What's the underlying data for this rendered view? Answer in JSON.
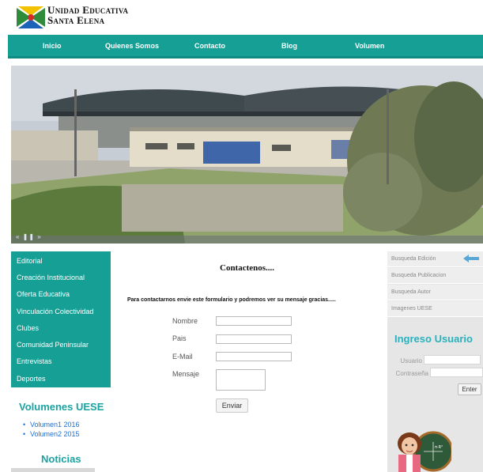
{
  "header": {
    "brand_line1": "Unidad Educativa",
    "brand_line2": "Santa Elena",
    "logo_icon": "school-logo-icon"
  },
  "nav": {
    "items": [
      "Inicio",
      "Quienes Somos",
      "Contacto",
      "Blog",
      "Volumen"
    ]
  },
  "banner": {
    "controls": "« ❚❚ »"
  },
  "left_menu": {
    "items": [
      "Editorial",
      "Creación Institucional",
      "Oferta Educativa",
      "Vinculación Colectividad",
      "Clubes",
      "Comunidad Peninsular",
      "Entrevistas",
      "Deportes"
    ]
  },
  "volumes": {
    "title": "Volumenes UESE",
    "items": [
      "Volumen1 2016",
      "Volumen2 2015"
    ]
  },
  "news": {
    "title": "Noticias"
  },
  "contact": {
    "title": "Contactenos....",
    "intro": "Para contactarnos envie este formulario y podremos ver su mensaje gracias.....",
    "labels": {
      "name": "Nombre",
      "country": "Pais",
      "email": "E-Mail",
      "message": "Mensaje"
    },
    "values": {
      "name": "",
      "country": "",
      "email": "",
      "message": ""
    },
    "submit": "Enviar"
  },
  "sidebar": {
    "items": [
      "Busqueda Edición",
      "Busqueda Publicacion",
      "Busqueda Autor",
      "Imagenes UESE"
    ],
    "login_title": "Ingreso Usuario",
    "user_label": "Usuario",
    "pass_label": "Contraseña",
    "enter_button": "Enter",
    "board_text": "π·R²"
  },
  "colors": {
    "teal": "#16a095",
    "teal_heading": "#1aa3a3",
    "login_heading": "#2bb0bd",
    "link_blue": "#1f6fd1"
  }
}
